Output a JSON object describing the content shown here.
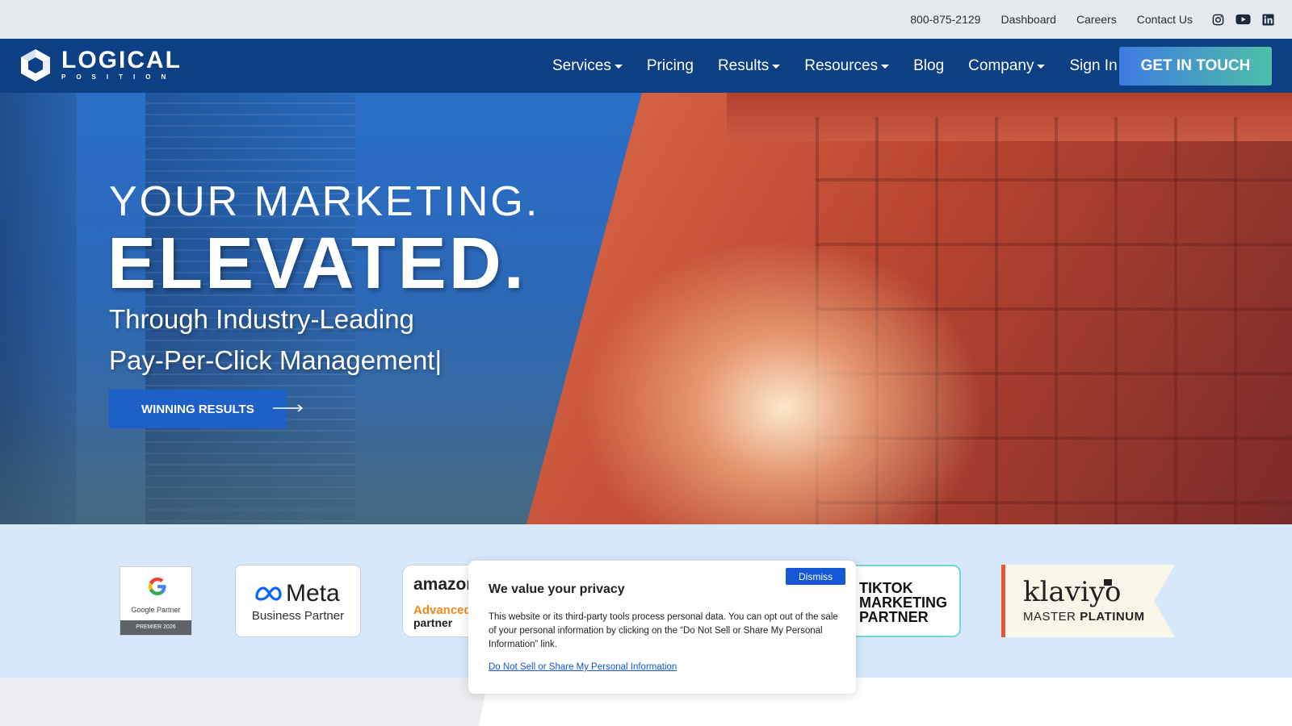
{
  "utility": {
    "phone": "800-875-2129",
    "links": [
      "Dashboard",
      "Careers",
      "Contact Us"
    ],
    "social_icons": [
      "instagram-icon",
      "youtube-icon",
      "linkedin-icon"
    ]
  },
  "nav": {
    "logo_word": "LOGICAL",
    "logo_sub": "POSITION",
    "items": [
      {
        "label": "Services",
        "dropdown": true
      },
      {
        "label": "Pricing",
        "dropdown": false
      },
      {
        "label": "Results",
        "dropdown": true
      },
      {
        "label": "Resources",
        "dropdown": true
      },
      {
        "label": "Blog",
        "dropdown": false
      },
      {
        "label": "Company",
        "dropdown": true
      },
      {
        "label": "Sign In",
        "dropdown": false
      }
    ],
    "cta": "GET IN TOUCH"
  },
  "hero": {
    "line1": "YOUR MARKETING.",
    "line2": "ELEVATED.",
    "sub1": "Through Industry-Leading",
    "sub2": "Pay-Per-Click Management|",
    "button": "WINNING RESULTS"
  },
  "partners": {
    "google_label": "Google Partner",
    "google_premier": "PREMIER 2026",
    "meta_word": "Meta",
    "meta_sub": "Business Partner",
    "amazon_word": "amazon",
    "amazon_advanced": "Advanced",
    "amazon_partner": "partner",
    "tiktok_lines": [
      "TIKTOK",
      "MARKETING",
      "PARTNER"
    ],
    "klaviyo_word": "klaviyo",
    "klaviyo_sub_1": "MASTER",
    "klaviyo_sub_2": "PLATINUM"
  },
  "privacy": {
    "dismiss": "Dismiss",
    "title": "We value your privacy",
    "body": "This website or its third-party tools process personal data. You can opt out of the sale of your personal information by clicking on the “Do Not Sell or Share My Personal Information” link.",
    "link": "Do Not Sell or Share My Personal Information"
  },
  "colors": {
    "nav_bg": "#0c3f84",
    "utility_bg": "#e6e9ee",
    "partner_strip_bg": "#d8e8fb",
    "cta_gradient_start": "#3e7be0",
    "cta_gradient_end": "#4dbfa8",
    "hero_button": "#1f5fc8",
    "dismiss_button": "#1458d6"
  }
}
